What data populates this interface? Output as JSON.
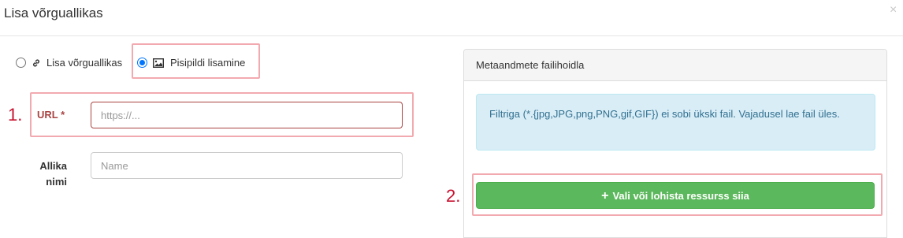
{
  "modal": {
    "title": "Lisa võrguallikas",
    "close_label": "×"
  },
  "mode_options": [
    {
      "label": "Lisa võrguallikas",
      "icon": "link-icon",
      "selected": false
    },
    {
      "label": "Pisipildi lisamine",
      "icon": "image-icon",
      "selected": true
    }
  ],
  "steps": {
    "first": "1.",
    "second": "2."
  },
  "form": {
    "url_label": "URL *",
    "url_placeholder": "https://...",
    "url_value": "",
    "source_name_label": "Allika nimi",
    "source_name_placeholder": "Name",
    "source_name_value": ""
  },
  "panel": {
    "heading": "Metaandmete failihoidla",
    "info_text": "Filtriga (*.{jpg,JPG,png,PNG,gif,GIF}) ei sobi ükski fail. Vajadusel lae fail üles.",
    "upload_button_icon": "plus-icon",
    "upload_button_label": "Vali või lohista ressurss siia"
  },
  "colors": {
    "success": "#5cb85c",
    "info_bg": "#d9edf7",
    "info_text": "#31708f",
    "error": "#a94442",
    "highlight_border": "#f2aab0",
    "step_number": "#c8102e"
  }
}
